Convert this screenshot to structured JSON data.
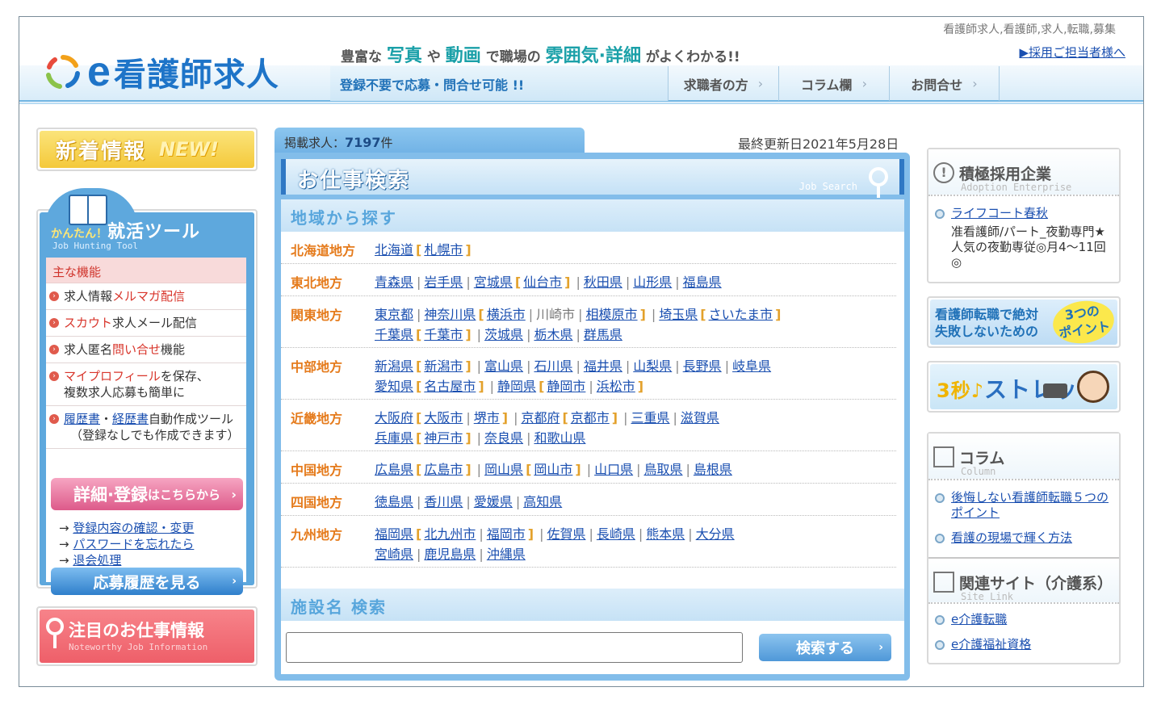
{
  "header": {
    "meta_keywords": "看護師求人,看護師,求人,転職,募集",
    "recruiter_link": "▶採用ご担当者様へ",
    "logo_e": "e",
    "logo_text": "看護師求人",
    "tagline": {
      "p1": "豊富な",
      "h1": "写真",
      "p2": "や",
      "h2": "動画",
      "p3": "で職場の",
      "h3": "雰囲気·詳細",
      "p4": "がよくわかる!!"
    },
    "notice": "登録不要で応募・問合せ可能 !!",
    "nav": [
      {
        "label": "求職者の方"
      },
      {
        "label": "コラム欄"
      },
      {
        "label": "お問合せ"
      }
    ],
    "chevron": "›"
  },
  "left": {
    "new_banner": {
      "t1": "新着情報",
      "t2": "NEW!"
    },
    "tool": {
      "title_small": "かんたん！",
      "title_big": "就活ツール",
      "subtitle": "Job Hunting Tool",
      "head": "主な機能",
      "items": [
        {
          "p1": "求人情報",
          "red": "メルマガ配信",
          "p2": ""
        },
        {
          "p1": "",
          "red": "スカウト",
          "p2": "求人メール配信"
        },
        {
          "p1": "求人匿名",
          "red": "問い合せ",
          "p2": "機能"
        },
        {
          "p1": "",
          "red": "マイプロフィール",
          "p2": "を保存、",
          "line2": "複数求人応募も簡単に"
        },
        {
          "link1": "履歴書",
          "mid": "・",
          "link2": "経歴書",
          "p2": "自動作成ツール",
          "line2": "（登録なしでも作成できます）"
        }
      ],
      "detail_button": {
        "big": "詳細·登録",
        "small": "はこちらから",
        "arrow": "›"
      },
      "links": [
        {
          "arrow": "→",
          "label": "登録内容の確認・変更"
        },
        {
          "arrow": "→",
          "label": "パスワードを忘れたら"
        },
        {
          "arrow": "→",
          "label": "退会処理"
        }
      ],
      "history_button": {
        "label": "応募履歴を見る",
        "arrow": "›"
      }
    },
    "notice_banner": {
      "t1": "注目のお仕事情報",
      "t2": "Noteworthy Job Information"
    }
  },
  "center": {
    "count_label": "掲載求人：",
    "count_value": "7197",
    "count_unit": "件",
    "updated": "最終更新日2021年5月28日",
    "search_title": "お仕事検索",
    "search_title_en": "Job Search",
    "region_head": "地域から探す",
    "regions": [
      {
        "name": "北海道地方",
        "html_key": "hokkaido"
      },
      {
        "name": "東北地方",
        "html_key": "tohoku"
      },
      {
        "name": "関東地方",
        "html_key": "kanto"
      },
      {
        "name": "中部地方",
        "html_key": "chubu"
      },
      {
        "name": "近畿地方",
        "html_key": "kinki"
      },
      {
        "name": "中国地方",
        "html_key": "chugoku"
      },
      {
        "name": "四国地方",
        "html_key": "shikoku"
      },
      {
        "name": "九州地方",
        "html_key": "kyushu"
      }
    ],
    "links": {
      "hokkaido": [
        "北海道",
        "札幌市"
      ],
      "tohoku": [
        "青森県",
        "岩手県",
        "宮城県",
        "仙台市",
        "秋田県",
        "山形県",
        "福島県"
      ],
      "kanto": [
        "東京都",
        "神奈川県",
        "横浜市",
        "川崎市",
        "相模原市",
        "埼玉県",
        "さいたま市",
        "千葉県",
        "千葉市",
        "茨城県",
        "栃木県",
        "群馬県"
      ],
      "chubu": [
        "新潟県",
        "新潟市",
        "富山県",
        "石川県",
        "福井県",
        "山梨県",
        "長野県",
        "岐阜県",
        "愛知県",
        "名古屋市",
        "静岡県",
        "静岡市",
        "浜松市"
      ],
      "kinki": [
        "大阪府",
        "大阪市",
        "堺市",
        "京都府",
        "京都市",
        "三重県",
        "滋賀県",
        "兵庫県",
        "神戸市",
        "奈良県",
        "和歌山県"
      ],
      "chugoku": [
        "広島県",
        "広島市",
        "岡山県",
        "岡山市",
        "山口県",
        "鳥取県",
        "島根県"
      ],
      "shikoku": [
        "徳島県",
        "香川県",
        "愛媛県",
        "高知県"
      ],
      "kyushu": [
        "福岡県",
        "北九州市",
        "福岡市",
        "佐賀県",
        "長崎県",
        "熊本県",
        "大分県",
        "宮崎県",
        "鹿児島県",
        "沖縄県"
      ]
    },
    "facility_head": "施設名 検索",
    "facility_value": "",
    "facility_button": "検索する",
    "facility_arrow": "›"
  },
  "right": {
    "adoption": {
      "title": "積極採用企業",
      "en": "Adoption Enterprise",
      "icon": "!",
      "company": "ライフコート春秋",
      "desc": "准看護師/パート_夜勤専門★人気の夜勤専従◎月4〜11回◎"
    },
    "point_banner": {
      "line1": "看護師転職で絶対",
      "line2": "失敗しないための",
      "badge1": "3つの",
      "badge2": "ポイント"
    },
    "stretch_banner": {
      "n": "3秒♪",
      "t": "ストレッチ"
    },
    "column": {
      "title": "コラム",
      "en": "Column",
      "items": [
        "後悔しない看護師転職５つのポイント",
        "看護の現場で輝く方法"
      ]
    },
    "sites": {
      "title": "関連サイト（介護系）",
      "en": "Site Link",
      "items": [
        "e介護転職",
        "e介護福祉資格"
      ]
    }
  },
  "colors": {
    "accent": "#1e74c8",
    "region": "#e57b1c",
    "link": "#1a4fb0",
    "pink": "#dd5a8a"
  }
}
